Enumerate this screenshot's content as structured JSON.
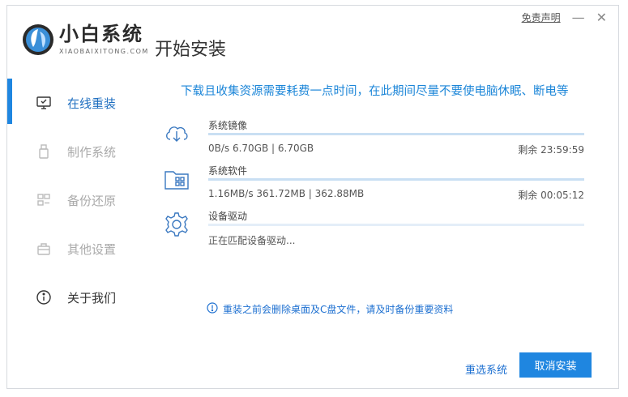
{
  "header": {
    "brand_title": "小白系统",
    "brand_subtitle": "XIAOBAIXITONG.COM",
    "page_title": "开始安装",
    "disclaimer": "免责声明",
    "minimize": "—",
    "close": "✕"
  },
  "sidebar": {
    "items": [
      {
        "label": "在线重装",
        "icon": "monitor-icon",
        "active": true
      },
      {
        "label": "制作系统",
        "icon": "usb-icon",
        "active": false
      },
      {
        "label": "备份还原",
        "icon": "backup-icon",
        "active": false
      },
      {
        "label": "其他设置",
        "icon": "briefcase-icon",
        "active": false
      },
      {
        "label": "关于我们",
        "icon": "info-icon",
        "active": false
      }
    ]
  },
  "notice_top": "下载且收集资源需要耗费一点时间，在此期间尽量不要使电脑休眠、断电等",
  "tasks": [
    {
      "name": "系统镜像",
      "detail": "0B/s 6.70GB | 6.70GB",
      "remaining": "剩余 23:59:59",
      "icon": "cloud-download-icon",
      "progress": 1.0
    },
    {
      "name": "系统软件",
      "detail": "1.16MB/s 361.72MB | 362.88MB",
      "remaining": "剩余 00:05:12",
      "icon": "folder-apps-icon",
      "progress": 1.0
    },
    {
      "name": "设备驱动",
      "detail": "正在匹配设备驱动...",
      "remaining": "",
      "icon": "gear-icon",
      "progress": 0.0
    }
  ],
  "warning": "重装之前会删除桌面及C盘文件，请及时备份重要资料",
  "footer": {
    "reselect": "重选系统",
    "cancel": "取消安装"
  },
  "colors": {
    "accent": "#1f86e0",
    "link": "#1c6fd0"
  }
}
